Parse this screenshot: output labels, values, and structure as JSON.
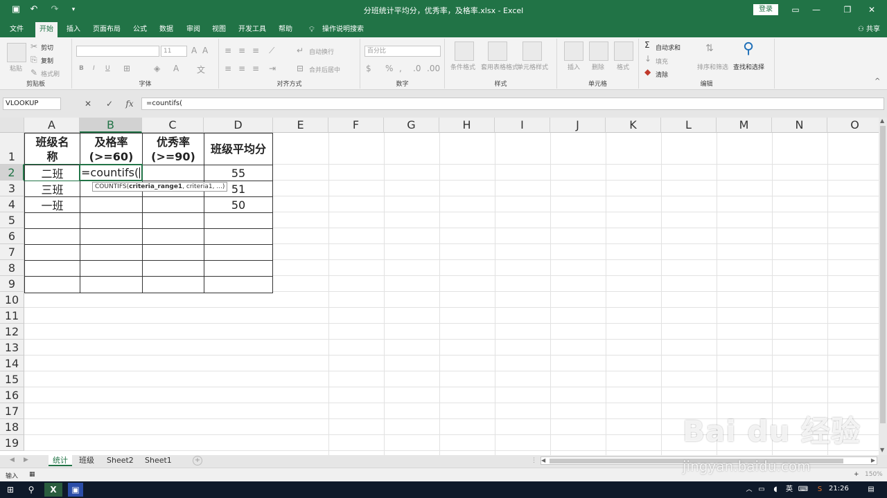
{
  "window": {
    "title": "分班统计平均分，优秀率，及格率.xlsx  -  Excel",
    "login_label": "登录",
    "share_label": "共享",
    "quick_access": [
      "save-icon",
      "undo-icon",
      "redo-icon",
      "customize-icon"
    ]
  },
  "ribbon_tabs": [
    "文件",
    "开始",
    "插入",
    "页面布局",
    "公式",
    "数据",
    "审阅",
    "视图",
    "开发工具",
    "帮助",
    "操作说明搜索"
  ],
  "ribbon": {
    "clipboard": {
      "label": "剪贴板",
      "paste": "粘贴",
      "cut": "剪切",
      "copy": "复制",
      "format_painter": "格式刷"
    },
    "font": {
      "label": "字体",
      "size": "11",
      "bold": "B",
      "italic": "I",
      "underline": "U"
    },
    "alignment": {
      "label": "对齐方式",
      "wrap": "自动换行",
      "merge": "合并后居中"
    },
    "number": {
      "label": "数字",
      "format": "百分比"
    },
    "styles": {
      "label": "样式",
      "conditional": "条件格式",
      "table": "套用表格格式",
      "cell_styles": "单元格样式"
    },
    "cells": {
      "label": "单元格",
      "insert": "插入",
      "delete": "删除",
      "format": "格式"
    },
    "editing": {
      "label": "编辑",
      "autosum": "自动求和",
      "fill": "填充",
      "clear": "清除",
      "sort": "排序和筛选",
      "find": "查找和选择"
    }
  },
  "formula_bar": {
    "name_box": "VLOOKUP",
    "formula": "=countifs("
  },
  "grid": {
    "columns": [
      "A",
      "B",
      "C",
      "D",
      "E",
      "F",
      "G",
      "H",
      "I",
      "J",
      "K",
      "L",
      "M",
      "N",
      "O"
    ],
    "rows": [
      "1",
      "2",
      "3",
      "4",
      "5",
      "6",
      "7",
      "8",
      "9",
      "10",
      "11",
      "12",
      "13",
      "14",
      "15",
      "16",
      "17",
      "18",
      "19"
    ],
    "headers": {
      "a1_line1": "班级名",
      "a1_line2": "称",
      "b1_line1": "及格率",
      "b1_line2": "(>=60)",
      "c1_line1": "优秀率",
      "c1_line2": "(>=90)",
      "d1": "班级平均分"
    },
    "classes": [
      "二班",
      "三班",
      "一班"
    ],
    "averages": [
      "55",
      "51",
      "50"
    ],
    "editing_cell": "=countifs(",
    "tooltip": {
      "prefix": "COUNTIFS(",
      "bold": "criteria_range1",
      "rest": ", criteria1, ...)"
    }
  },
  "sheets": [
    "统计",
    "班级",
    "Sheet2",
    "Sheet1"
  ],
  "status": {
    "mode": "输入",
    "zoom": "150%"
  },
  "taskbar": {
    "time": "21:26",
    "ime": "英"
  },
  "watermark": {
    "logo": "Bai du 经验",
    "url": "jingyan.baidu.com"
  }
}
